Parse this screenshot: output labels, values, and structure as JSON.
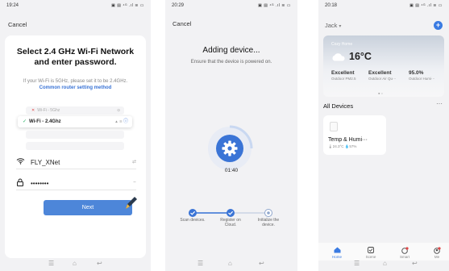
{
  "screens": [
    {
      "status": {
        "time": "19:24",
        "icons": "▣ ▤ ⁴ᴳ .ıl ≋ ▭"
      },
      "cancel_label": "Cancel",
      "title": "Select 2.4 GHz Wi-Fi Network and enter password.",
      "hint_text": "If your Wi-Fi is 5GHz, please set it to be 2.4GHz.",
      "hint_link": "Common router setting method",
      "wifi_rows": [
        {
          "ssid": "Wi-Fi - 5Ghz",
          "status_icon": "x-icon"
        },
        {
          "ssid": "Wi-Fi - 2.4Ghz",
          "status_icon": "check-icon"
        }
      ],
      "network_name": "FLY_XNet",
      "password_value": "••••••••",
      "next_label": "Next",
      "accent": "#4d86d9"
    },
    {
      "status": {
        "time": "20:29",
        "icons": "▣ ▤ ⁴ᴳ .ıl ≋ ▭"
      },
      "cancel_label": "Cancel",
      "title": "Adding device...",
      "subtitle": "Ensure that the device is powered on.",
      "timer": "01:40",
      "steps": [
        "Scan devices.",
        "Register on Cloud.",
        "Initialize the device."
      ],
      "steps_done": 2,
      "accent": "#3a74d6"
    },
    {
      "status": {
        "time": "20:18",
        "icons": "▣ ▤ ⁴ᴳ .ıl ≋ ▭"
      },
      "home_name": "Jack",
      "weather": {
        "label": "Cozy Home",
        "temperature": "16°C",
        "stats": [
          {
            "value": "Excellent",
            "label": "Outdoor PM2.5"
          },
          {
            "value": "Excellent",
            "label": "Outdoor Air Qu···"
          },
          {
            "value": "95.0%",
            "label": "Outdoor Humi···"
          }
        ]
      },
      "section_title": "All Devices",
      "device": {
        "name": "Temp & Humi···",
        "stats": "🌡24.3°C 💧57%"
      },
      "tabs": [
        {
          "label": "Home",
          "icon": "home-icon",
          "active": true
        },
        {
          "label": "Scene",
          "icon": "scene-icon",
          "active": false
        },
        {
          "label": "Smart",
          "icon": "smart-icon",
          "active": false
        },
        {
          "label": "Me",
          "icon": "me-icon",
          "active": false
        }
      ],
      "accent": "#3a7be2"
    }
  ],
  "nav_icons": [
    "menu-icon",
    "home-outline-icon",
    "back-icon"
  ]
}
